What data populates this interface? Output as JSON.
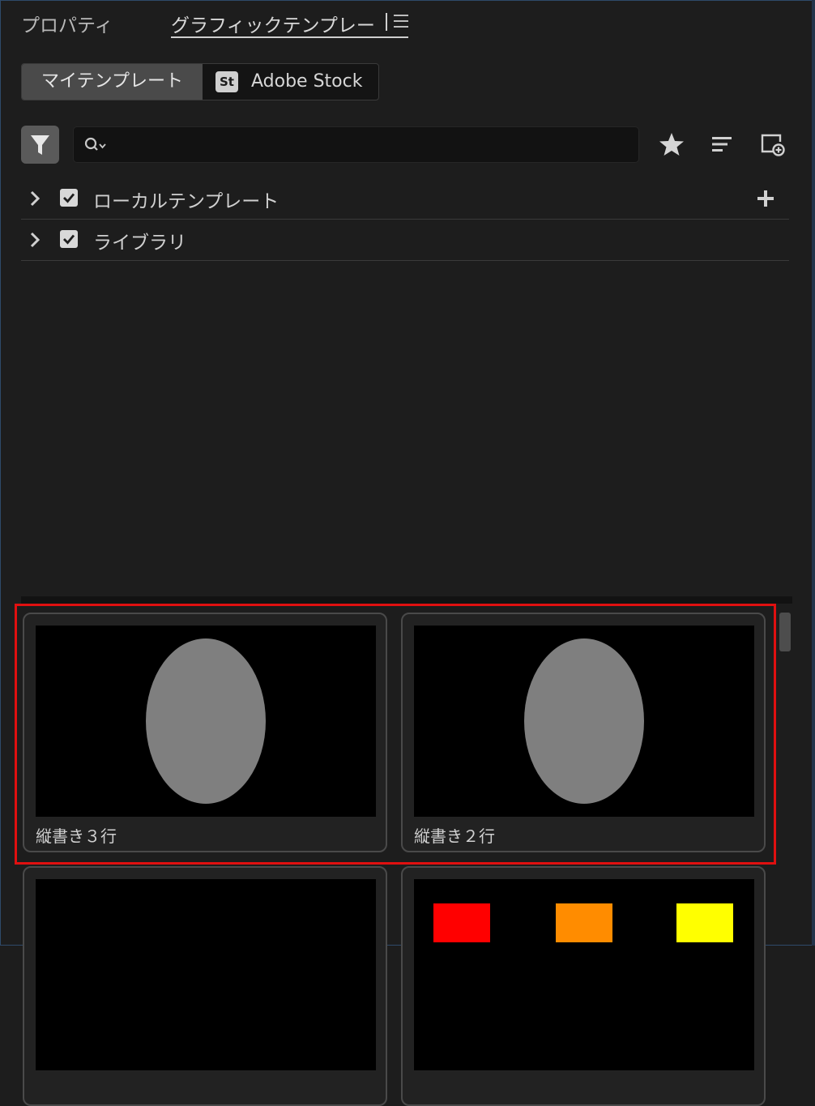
{
  "panel_tabs": {
    "properties": "プロパティ",
    "graphic_templates": "グラフィックテンプレー"
  },
  "segment": {
    "my_templates": "マイテンプレート",
    "stock_badge": "St",
    "stock": "Adobe Stock"
  },
  "search": {
    "value": "",
    "placeholder": ""
  },
  "icons": {
    "filter": "filter-icon",
    "search": "search-icon",
    "favorites": "star-icon",
    "sort": "sort-icon",
    "new_template": "new-template-icon",
    "menu": "hamburger-icon",
    "add": "plus-icon"
  },
  "tree": [
    {
      "label": "ローカルテンプレート",
      "checked": true,
      "has_add": true
    },
    {
      "label": "ライブラリ",
      "checked": true,
      "has_add": false
    }
  ],
  "templates": [
    {
      "title": "縦書き３行",
      "thumb": "gray-ellipse"
    },
    {
      "title": "縦書き２行",
      "thumb": "gray-ellipse"
    },
    {
      "title": "",
      "thumb": "black"
    },
    {
      "title": "",
      "thumb": "color-swatches",
      "swatches": [
        "#ff0000",
        "#ff8c00",
        "#ffff00"
      ]
    }
  ],
  "colors": {
    "highlight": "#e01010",
    "panel_bg": "#1d1d1d",
    "ellipse": "#7f7f7f"
  }
}
